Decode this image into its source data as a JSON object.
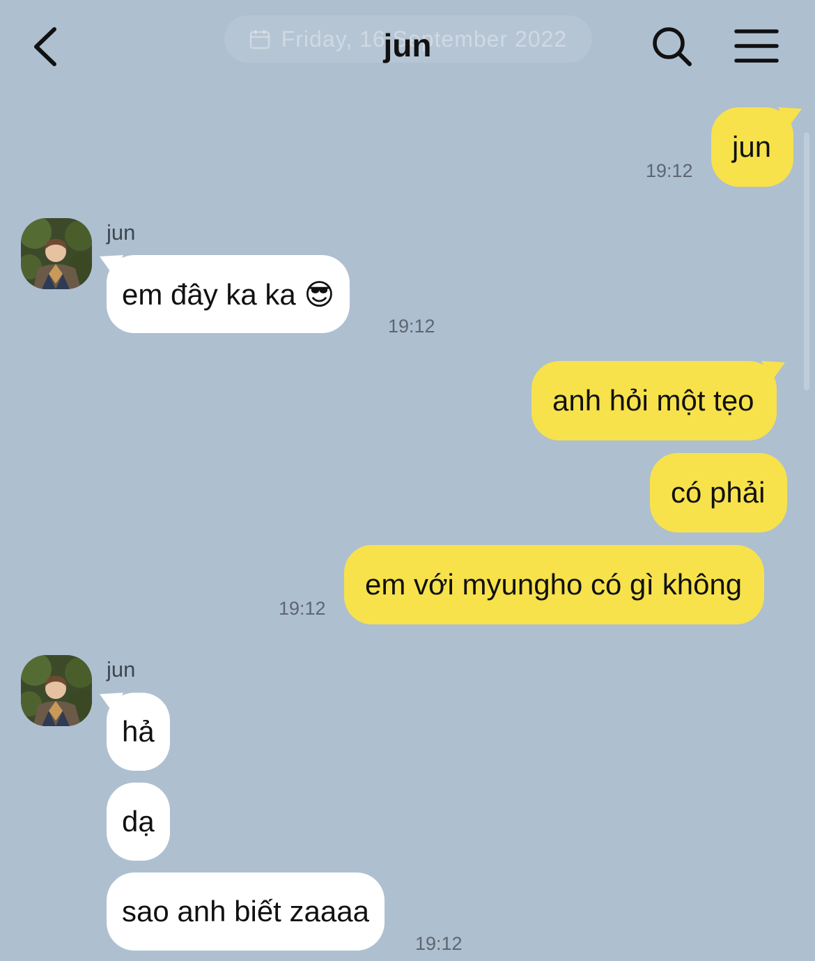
{
  "header": {
    "title": "jun",
    "date_overlay": "Friday, 16 September 2022"
  },
  "icons": {
    "back": "chevron-left-icon",
    "search": "search-icon",
    "menu": "hamburger-menu-icon",
    "date": "calendar-icon"
  },
  "colors": {
    "background": "#aebfd0",
    "outgoing_bubble": "#f7e24c",
    "incoming_bubble": "#ffffff"
  },
  "messages": [
    {
      "direction": "out",
      "text": "jun"
    },
    {
      "direction": "out",
      "time": "19:12"
    },
    {
      "direction": "in",
      "sender": "jun",
      "text": "em đây ka ka 😎",
      "time": "19:12"
    },
    {
      "direction": "out",
      "text": "anh hỏi một tẹo"
    },
    {
      "direction": "out",
      "text": "có phải"
    },
    {
      "direction": "out",
      "text": "em với myungho có gì không",
      "time": "19:12"
    },
    {
      "direction": "in",
      "sender": "jun",
      "text": "hả"
    },
    {
      "direction": "in",
      "text": "dạ"
    },
    {
      "direction": "in",
      "text": "sao anh biết zaaaa",
      "time": "19:12"
    }
  ]
}
